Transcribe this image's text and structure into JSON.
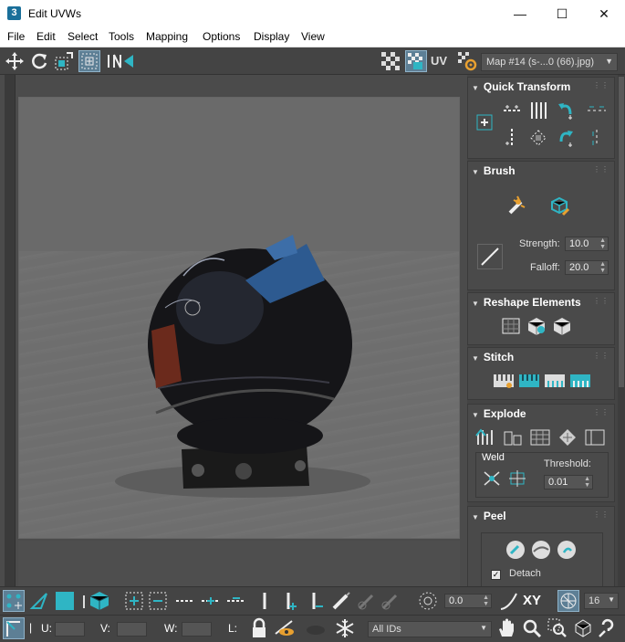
{
  "window": {
    "app_number": "3",
    "title": "Edit UVWs",
    "minimize": "—",
    "maximize": "☐",
    "close": "✕"
  },
  "menu": [
    "File",
    "Edit",
    "Select",
    "Tools",
    "Mapping",
    "Options",
    "Display",
    "View"
  ],
  "toolbar": {
    "uv_label": "UV",
    "map_selector": "Map #14 (s-...0 (66).jpg)"
  },
  "panel": {
    "quick_transform": {
      "title": "Quick Transform"
    },
    "brush": {
      "title": "Brush",
      "strength_label": "Strength:",
      "strength_value": "10.0",
      "falloff_label": "Falloff:",
      "falloff_value": "20.0"
    },
    "reshape": {
      "title": "Reshape Elements"
    },
    "stitch": {
      "title": "Stitch"
    },
    "explode": {
      "title": "Explode",
      "weld_label": "Weld",
      "threshold_label": "Threshold:",
      "threshold_value": "0.01"
    },
    "peel": {
      "title": "Peel",
      "detach_label": "Detach",
      "detach_checked": true
    }
  },
  "bottom1": {
    "angle_value": "0.0",
    "xy_label": "XY",
    "grid_value": "16"
  },
  "bottom2": {
    "u_label": "U:",
    "v_label": "V:",
    "w_label": "W:",
    "l_label": "L:",
    "id_filter": "All IDs"
  },
  "colors": {
    "accent": "#2fb5c4",
    "background": "#444444",
    "panel": "#4a4a4a"
  }
}
